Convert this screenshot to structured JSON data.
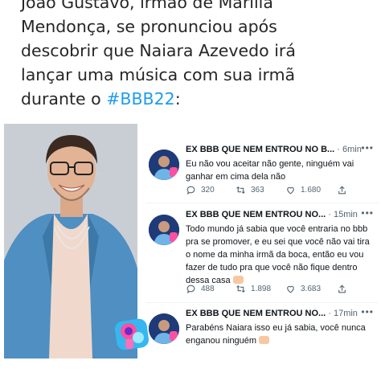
{
  "headline": {
    "line1": "João Gustavo, irmão de Marília",
    "line2": "Mendonça, se pronunciou após",
    "line3": "descobrir que Naiara Azevedo irá",
    "line4": "lançar uma música com sua irmã",
    "line5_prefix": "durante o ",
    "hashtag": "#BBB22",
    "line5_suffix": ":"
  },
  "tweets": [
    {
      "name": "EX BBB QUE NEM ENTROU NO B...",
      "time": "· 6min",
      "text": "Eu não vou aceitar não gente, ninguém vai ganhar em cima dela não",
      "replies": "320",
      "retweets": "363",
      "likes": "1.680"
    },
    {
      "name": "EX BBB QUE NEM ENTROU NO...",
      "time": "· 15min",
      "text": "Todo mundo já sabia que você entraria no bbb pra se promover, e eu sei que você não vai tira o nome da minha irmã da boca, então eu vou fazer de tudo pra que você não fique dentro dessa casa",
      "replies": "488",
      "retweets": "1.898",
      "likes": "3.683"
    },
    {
      "name": "EX BBB QUE NEM ENTROU NO...",
      "time": "· 17min",
      "text": "Parabéns Naiara isso eu já sabia, você nunca enganou ninguém"
    }
  ],
  "icons": {
    "more": "more-dots-icon",
    "reply": "reply-icon",
    "retweet": "retweet-icon",
    "like": "heart-icon",
    "share": "share-icon",
    "emoji": "clapping-hands-emoji"
  },
  "colors": {
    "hashtag": "#1d9bf0",
    "text": "#0f1419",
    "secondary": "#536471"
  }
}
